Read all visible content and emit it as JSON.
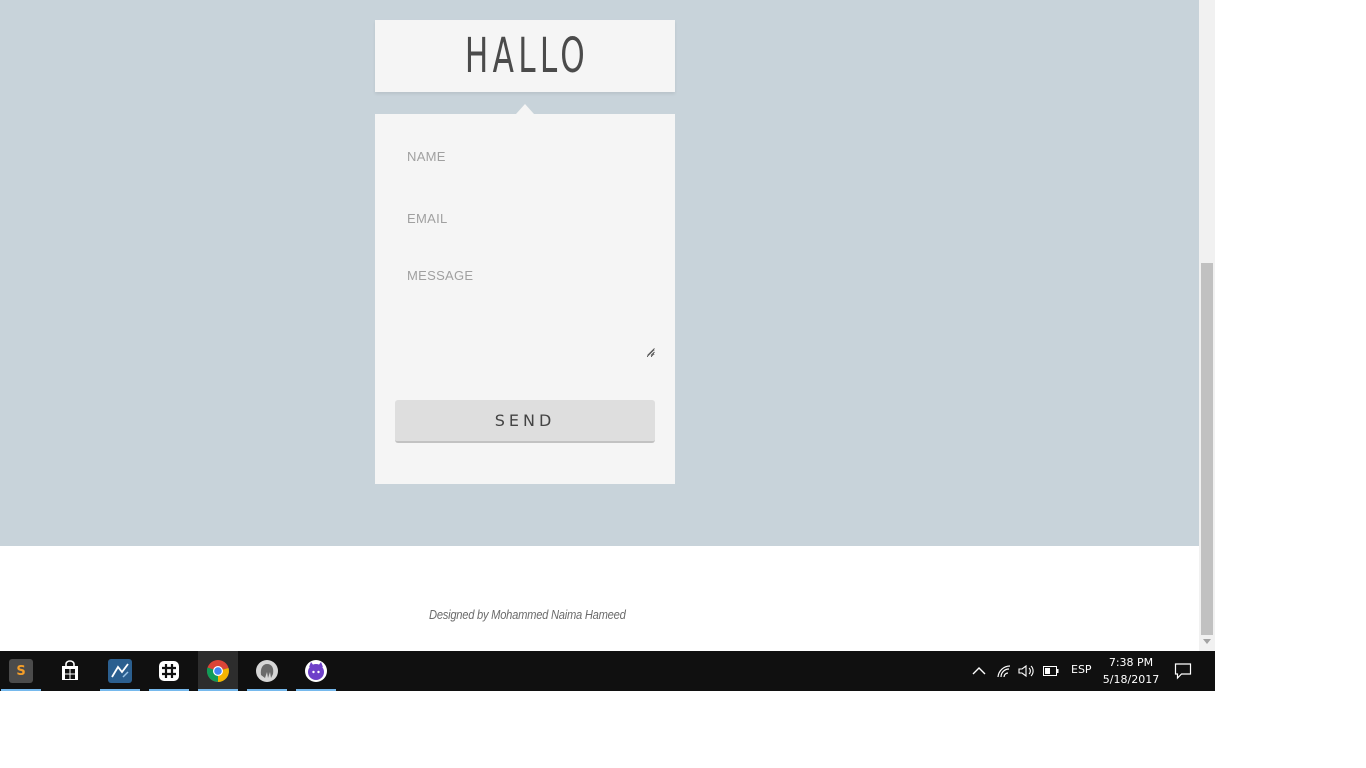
{
  "form": {
    "title": "HALLO",
    "name_placeholder": "NAME",
    "email_placeholder": "EMAIL",
    "message_placeholder": "MESSAGE",
    "send_label": "SEND"
  },
  "footer": {
    "credit": "Designed by Mohammed Naima Hameed"
  },
  "taskbar": {
    "apps": [
      {
        "name": "sublime-text-icon",
        "glyph": "S"
      },
      {
        "name": "windows-store-icon",
        "glyph": ""
      },
      {
        "name": "mysql-workbench-icon",
        "glyph": ""
      },
      {
        "name": "slack-icon",
        "glyph": ""
      },
      {
        "name": "chrome-icon",
        "glyph": ""
      },
      {
        "name": "pgadmin-icon",
        "glyph": ""
      },
      {
        "name": "github-desktop-icon",
        "glyph": ""
      }
    ],
    "language": "ESP",
    "time": "7:38 PM",
    "date": "5/18/2017"
  },
  "colors": {
    "hero_bg": "#c8d3da",
    "card_bg": "#f5f5f5",
    "button_bg": "#dedede",
    "taskbar_bg": "#101010",
    "taskbar_accent": "#76b9ed"
  }
}
